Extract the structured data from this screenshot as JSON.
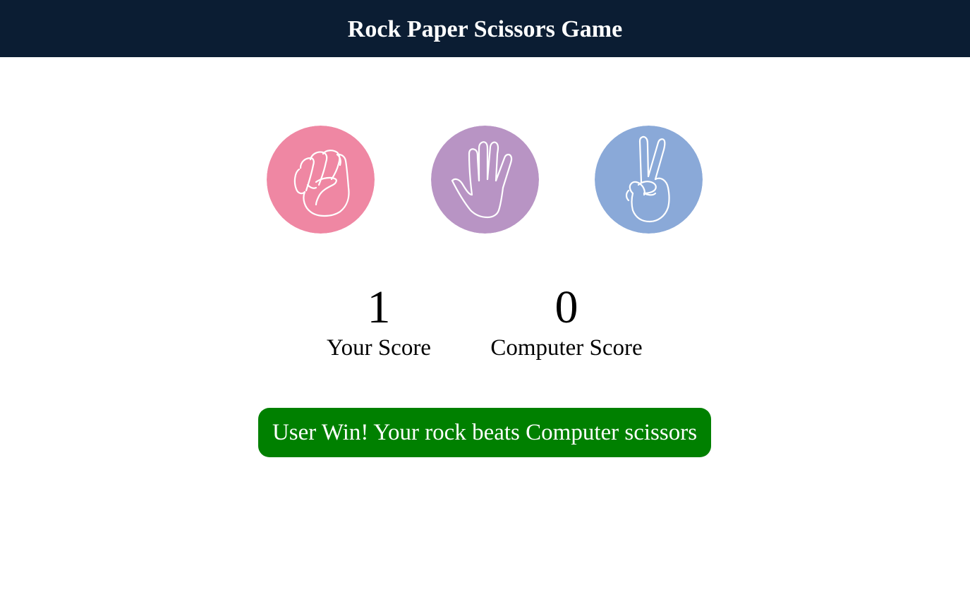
{
  "header": {
    "title": "Rock Paper Scissors Game",
    "background": "#0b1d33"
  },
  "choices": [
    {
      "id": "rock",
      "icon": "fist-hand-icon",
      "color": "#ef87a3"
    },
    {
      "id": "paper",
      "icon": "open-hand-icon",
      "color": "#b894c4"
    },
    {
      "id": "scissors",
      "icon": "peace-sign-hand-icon",
      "color": "#8aa9d8"
    }
  ],
  "scores": {
    "user": {
      "value": "1",
      "label": "Your Score"
    },
    "computer": {
      "value": "0",
      "label": "Computer Score"
    }
  },
  "message": {
    "text": "User Win! Your rock beats Computer scissors",
    "color": "#008000"
  }
}
